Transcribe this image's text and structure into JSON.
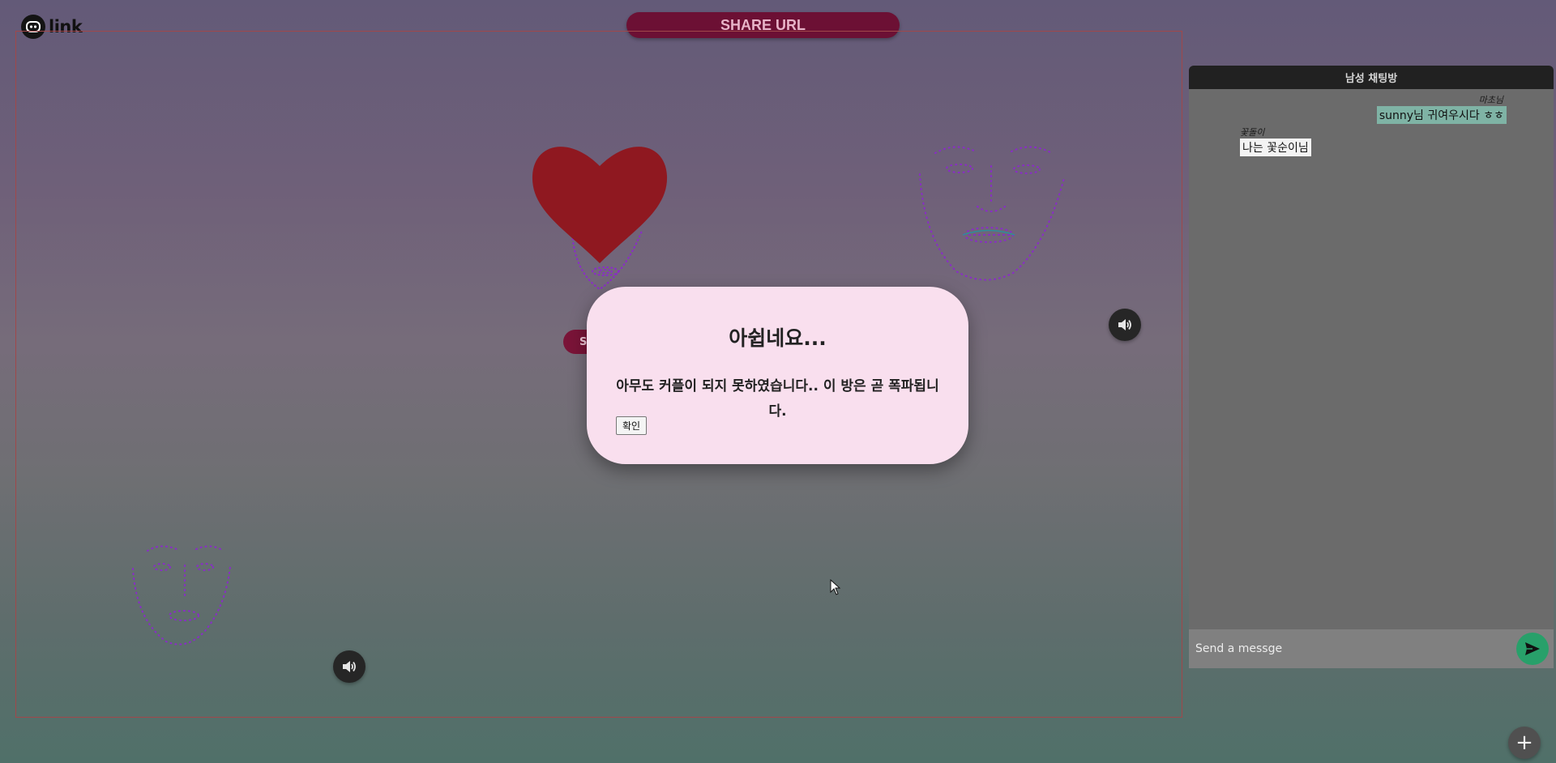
{
  "brand": {
    "logo_text": "link"
  },
  "header": {
    "share_label": "SHARE URL"
  },
  "stage": {
    "name_pill_label": "S",
    "sound_icons": [
      "speaker-icon",
      "speaker-icon"
    ]
  },
  "modal": {
    "title": "아쉽네요...",
    "message": "아무도 커플이 되지 못하였습니다.. 이 방은 곧 폭파됩니다.",
    "confirm_label": "확인"
  },
  "chat": {
    "title": "남성 채팅방",
    "messages": [
      {
        "author": "마초님",
        "text": "sunny님 귀여우시다 ㅎㅎ",
        "own": true
      },
      {
        "author": "꽃돌이",
        "text": "나는 꽃순이님",
        "own": false
      }
    ],
    "input_placeholder": "Send a messge",
    "send_icon": "send-icon"
  },
  "floating": {
    "plus_label": "+"
  },
  "colors": {
    "accent": "#6c1034",
    "heart": "#8f1820",
    "modal_bg": "#f9dfee",
    "send": "#28a06a",
    "landmarks": "#8a2bc9"
  }
}
